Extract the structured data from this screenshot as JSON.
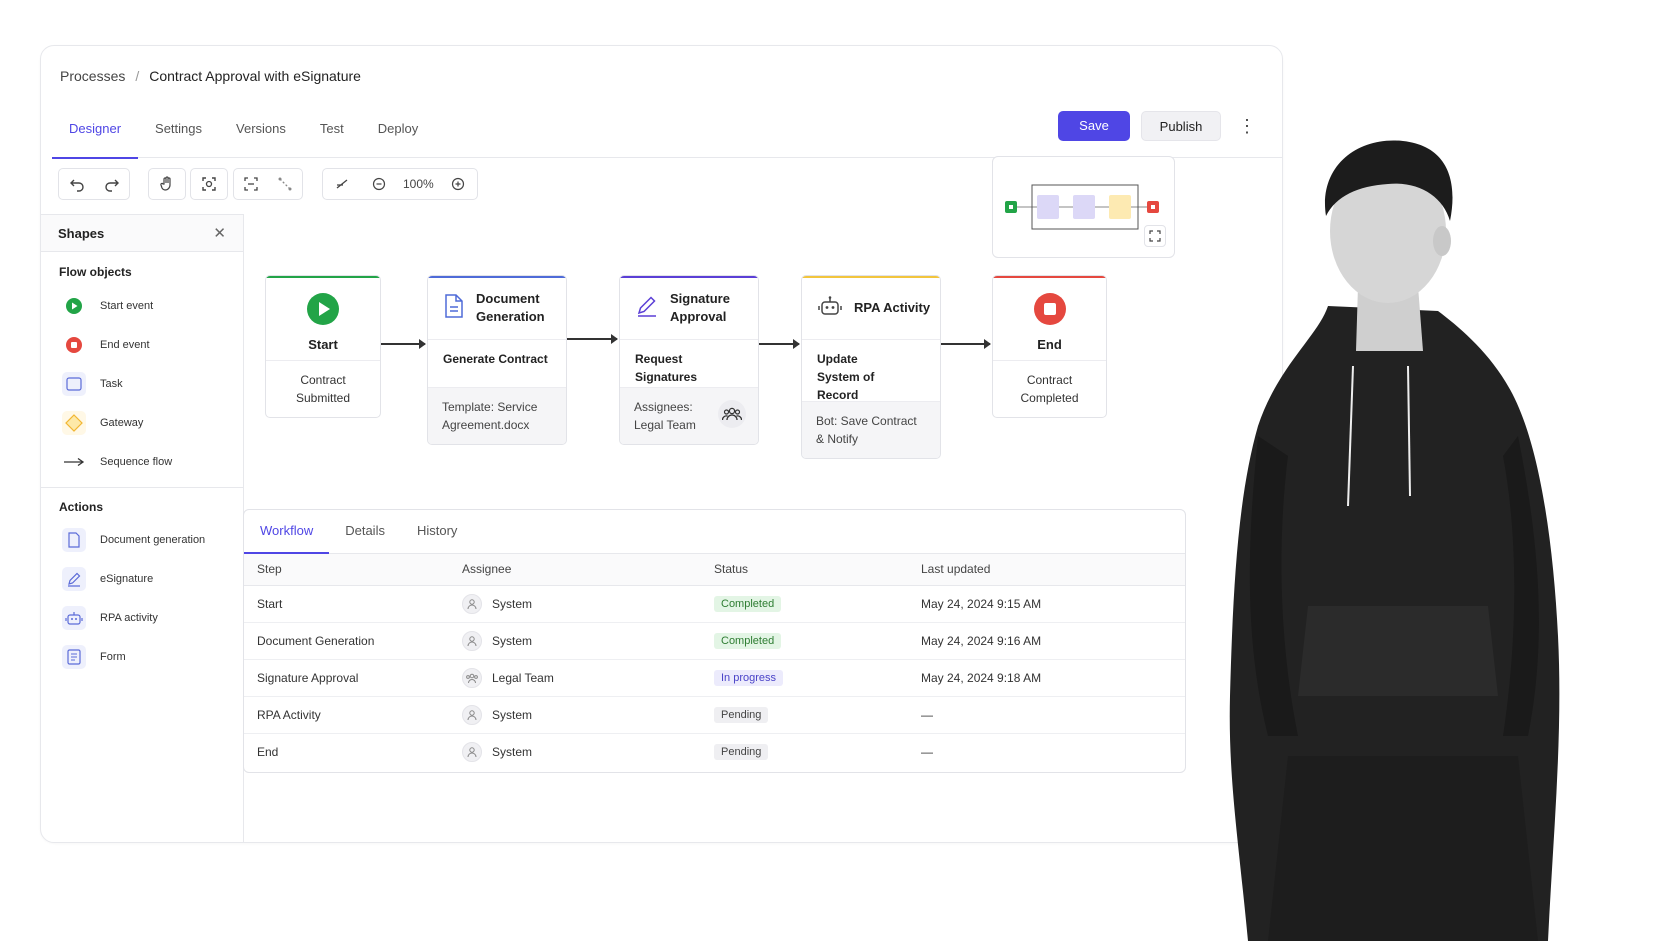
{
  "breadcrumb": {
    "root": "Processes",
    "separator": "/",
    "current": "Contract Approval with eSignature"
  },
  "tabs": [
    "Designer",
    "Settings",
    "Versions",
    "Test",
    "Deploy"
  ],
  "active_tab": "Designer",
  "header_actions": {
    "save": "Save",
    "publish": "Publish",
    "more": "⋮"
  },
  "toolbar": {
    "zoom": "100%"
  },
  "sidebar": {
    "title": "Shapes",
    "sections": [
      {
        "title": "Flow objects",
        "items": [
          "Start event",
          "End event",
          "Task",
          "Gateway",
          "Sequence flow"
        ]
      },
      {
        "title": "Actions",
        "items": [
          "Document generation",
          "eSignature",
          "RPA activity",
          "Form"
        ]
      }
    ]
  },
  "flow": {
    "start": {
      "title": "Start",
      "body": "Contract Submitted",
      "color": "#22a447"
    },
    "doc": {
      "title": "Document Generation",
      "body": "Generate Contract",
      "footer": "Template: Service Agreement.docx",
      "color": "#4f6bd8"
    },
    "sign": {
      "title": "Signature Approval",
      "body": "Request Signatures",
      "footer": "Assignees: Legal Team",
      "color": "#5b3fd6"
    },
    "rpa": {
      "title": "RPA Activity",
      "body": "Update System of Record",
      "footer": "Bot: Save Contract & Notify",
      "color": "#f2c53d"
    },
    "end": {
      "title": "End",
      "body": "Contract Completed",
      "color": "#e5483f"
    }
  },
  "panel": {
    "tabs": [
      "Workflow",
      "Details",
      "History"
    ],
    "active_tab": "Workflow",
    "columns": [
      "Step",
      "Assignee",
      "Status",
      "Last updated"
    ],
    "rows": [
      {
        "step": "Start",
        "assignee": "System",
        "status": "Completed",
        "updated": "May 24, 2024 9:15 AM"
      },
      {
        "step": "Document Generation",
        "assignee": "System",
        "status": "Completed",
        "updated": "May 24, 2024 9:16 AM"
      },
      {
        "step": "Signature Approval",
        "assignee": "Legal Team",
        "status": "In progress",
        "updated": "May 24, 2024 9:18 AM"
      },
      {
        "step": "RPA Activity",
        "assignee": "System",
        "status": "Pending",
        "updated": "—"
      },
      {
        "step": "End",
        "assignee": "System",
        "status": "Pending",
        "updated": "—"
      }
    ]
  },
  "colors": {
    "accent": "#4f46e5",
    "completed": "#2e7d32",
    "in_progress": "#4a43c8"
  }
}
